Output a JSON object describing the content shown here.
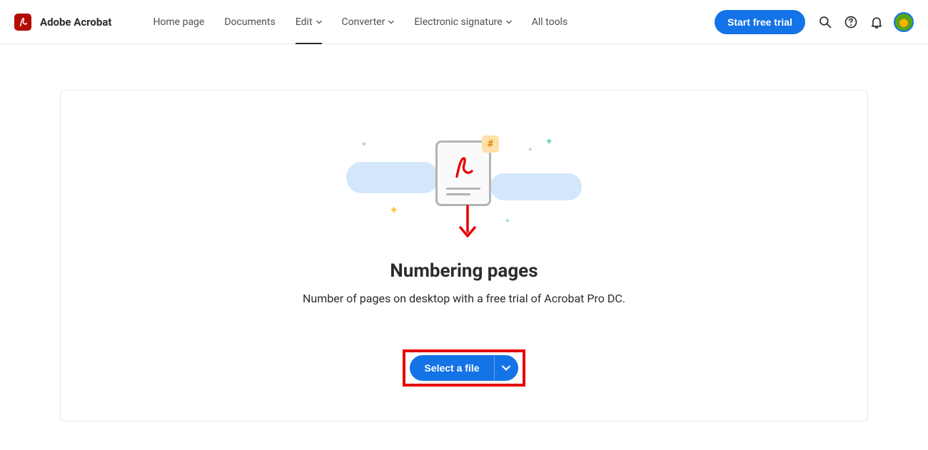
{
  "header": {
    "brand": "Adobe Acrobat",
    "nav": {
      "home": "Home page",
      "documents": "Documents",
      "edit": "Edit",
      "converter": "Converter",
      "esign": "Electronic signature",
      "alltools": "All tools"
    },
    "cta": "Start free trial"
  },
  "main": {
    "title": "Numbering pages",
    "subtitle": "Number of pages on desktop with a free trial of Acrobat Pro DC.",
    "hash": "#",
    "select_label": "Select a file"
  }
}
